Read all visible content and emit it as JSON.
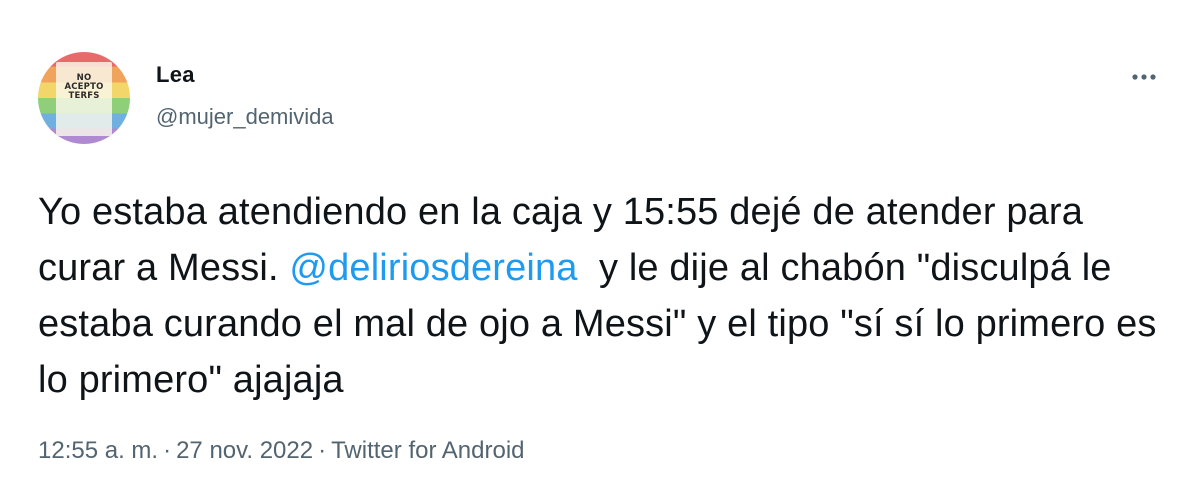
{
  "author": {
    "display_name": "Lea",
    "handle": "@mujer_demivida",
    "avatar_text": "NO ACEPTO TERFS"
  },
  "more_icon": "more-horizontal-icon",
  "tweet": {
    "text_before": "Yo estaba atendiendo en la caja y 15:55 dejé de atender para curar a Messi. ",
    "mention": "@deliriosdereina",
    "text_after": "  y le dije al chabón \"disculpá le estaba curando el mal de ojo a Messi\" y el tipo \"sí sí lo primero es lo primero\" ajajaja"
  },
  "meta": {
    "time": "12:55 a. m.",
    "separator": "·",
    "date": "27 nov. 2022",
    "source": "Twitter for Android"
  },
  "colors": {
    "text": "#0f1419",
    "secondary": "#536471",
    "link": "#1d9bf0"
  }
}
